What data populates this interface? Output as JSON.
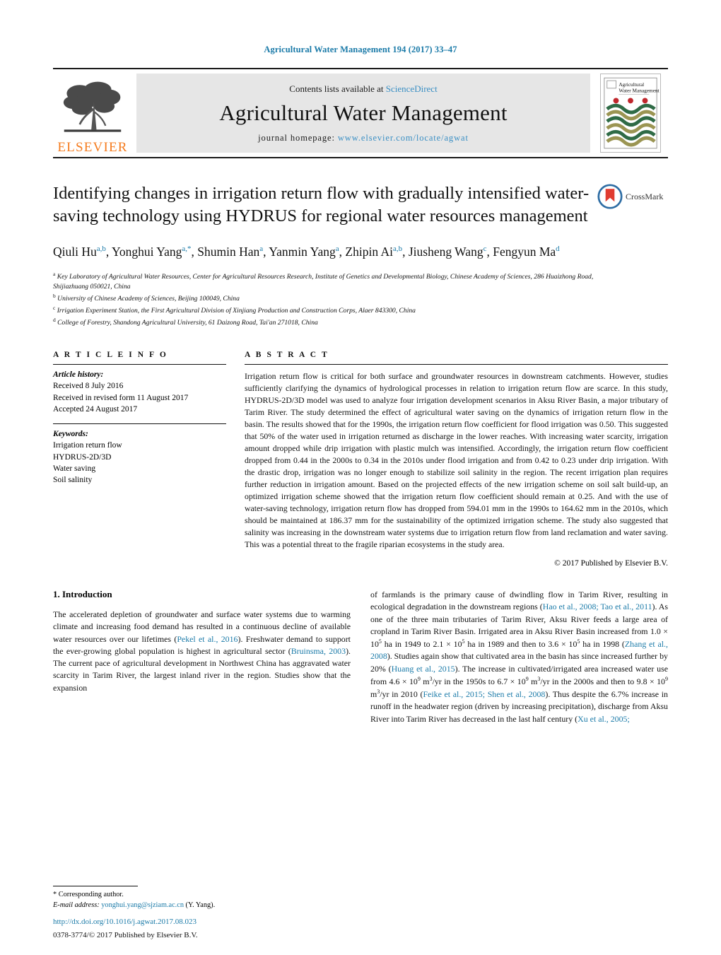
{
  "running_head": "Agricultural Water Management 194 (2017) 33–47",
  "masthead": {
    "contents_prefix": "Contents lists available at ",
    "sciencedirect": "ScienceDirect",
    "journal_name": "Agricultural Water Management",
    "homepage_prefix": "journal homepage:",
    "homepage_url": "www.elsevier.com/locate/agwat",
    "publisher_wordmark": "ELSEVIER",
    "cover_title_line1": "Agricultural",
    "cover_title_line2": "Water Management",
    "colors": {
      "link": "#3a8fc4",
      "elsevier_orange": "#f57c1f",
      "running_head": "#1a7aa8",
      "masthead_bg": "#e6e6e6"
    }
  },
  "title": "Identifying changes in irrigation return flow with gradually intensified water-saving technology using HYDRUS for regional water resources management",
  "crossmark_label": "CrossMark",
  "authors_html": "Qiuli Hu<sup>a,b</sup>, Yonghui Yang<sup>a,*</sup>, Shumin Han<sup>a</sup>, Yanmin Yang<sup>a</sup>, Zhipin Ai<sup>a,b</sup>, Jiusheng Wang<sup>c</sup>, Fengyun Ma<sup>d</sup>",
  "affiliations": [
    {
      "marker": "a",
      "text": "Key Laboratory of Agricultural Water Resources, Center for Agricultural Resources Research, Institute of Genetics and Developmental Biology, Chinese Academy of Sciences, 286 Huaizhong Road, Shijiazhuang 050021, China"
    },
    {
      "marker": "b",
      "text": "University of Chinese Academy of Sciences, Beijing 100049, China"
    },
    {
      "marker": "c",
      "text": "Irrigation Experiment Station, the First Agricultural Division of Xinjiang Production and Construction Corps, Alaer 843300, China"
    },
    {
      "marker": "d",
      "text": "College of Forestry, Shandong Agricultural University, 61 Daizong Road, Tai'an 271018, China"
    }
  ],
  "article_info": {
    "label": "A R T I C L E   I N F O",
    "history_heading": "Article history:",
    "history": [
      "Received 8 July 2016",
      "Received in revised form 11 August 2017",
      "Accepted 24 August 2017"
    ],
    "keywords_heading": "Keywords:",
    "keywords": [
      "Irrigation return flow",
      "HYDRUS-2D/3D",
      "Water saving",
      "Soil salinity"
    ]
  },
  "abstract": {
    "label": "A B S T R A C T",
    "text": "Irrigation return flow is critical for both surface and groundwater resources in downstream catchments. However, studies sufficiently clarifying the dynamics of hydrological processes in relation to irrigation return flow are scarce. In this study, HYDRUS-2D/3D model was used to analyze four irrigation development scenarios in Aksu River Basin, a major tributary of Tarim River. The study determined the effect of agricultural water saving on the dynamics of irrigation return flow in the basin. The results showed that for the 1990s, the irrigation return flow coefficient for flood irrigation was 0.50. This suggested that 50% of the water used in irrigation returned as discharge in the lower reaches. With increasing water scarcity, irrigation amount dropped while drip irrigation with plastic mulch was intensified. Accordingly, the irrigation return flow coefficient dropped from 0.44 in the 2000s to 0.34 in the 2010s under flood irrigation and from 0.42 to 0.23 under drip irrigation. With the drastic drop, irrigation was no longer enough to stabilize soil salinity in the region. The recent irrigation plan requires further reduction in irrigation amount. Based on the projected effects of the new irrigation scheme on soil salt build-up, an optimized irrigation scheme showed that the irrigation return flow coefficient should remain at 0.25. And with the use of water-saving technology, irrigation return flow has dropped from 594.01 mm in the 1990s to 164.62 mm in the 2010s, which should be maintained at 186.37 mm for the sustainability of the optimized irrigation scheme. The study also suggested that salinity was increasing in the downstream water systems due to irrigation return flow from land reclamation and water saving. This was a potential threat to the fragile riparian ecosystems in the study area.",
    "copyright": "© 2017 Published by Elsevier B.V."
  },
  "introduction": {
    "heading": "1.  Introduction",
    "left_html": "<span class=\"indent\">The accelerated depletion of groundwater and surface water systems due to warming climate and increasing food demand has resulted in a continuous decline of available water resources over our lifetimes (<span class=\"cite\">Pekel et al., 2016</span>). Freshwater demand to support the ever-growing global population is highest in agricultural sector (<span class=\"cite\">Bruinsma, 2003</span>). The current pace of agricultural development in Northwest China has aggravated water scarcity in Tarim River, the largest inland river in the region. Studies show that the expansion</span>",
    "right_html": "of farmlands is the primary cause of dwindling flow in Tarim River, resulting in ecological degradation in the downstream regions (<span class=\"cite\">Hao et al., 2008; Tao et al., 2011</span>). As one of the three main tributaries of Tarim River, Aksu River feeds a large area of cropland in Tarim River Basin. Irrigated area in Aksu River Basin increased from 1.0 × 10<sup>5</sup> ha in 1949 to 2.1 × 10<sup>5</sup> ha in 1989 and then to 3.6 × 10<sup>5</sup> ha in 1998 (<span class=\"cite\">Zhang et al., 2008</span>). Studies again show that cultivated area in the basin has since increased further by 20% (<span class=\"cite\">Huang et al., 2015</span>). The increase in cultivated/irrigated area increased water use from 4.6 × 10<sup>9</sup> m<sup>3</sup>/yr in the 1950s to 6.7 × 10<sup>9</sup> m<sup>3</sup>/yr in the 2000s and then to 9.8 × 10<sup>9</sup> m<sup>3</sup>/yr in 2010 (<span class=\"cite\">Feike et al., 2015; Shen et al., 2008</span>). Thus despite the 6.7% increase in runoff in the headwater region (driven by increasing precipitation), discharge from Aksu River into Tarim River has decreased in the last half century (<span class=\"cite\">Xu et al., 2005;</span>"
  },
  "footnote": {
    "corresponding": "*  Corresponding author.",
    "email_label": "E-mail address:",
    "email": "yonghui.yang@sjziam.ac.cn",
    "email_suffix": " (Y. Yang)."
  },
  "doi": "http://dx.doi.org/10.1016/j.agwat.2017.08.023",
  "issn_line": "0378-3774/© 2017 Published by Elsevier B.V."
}
